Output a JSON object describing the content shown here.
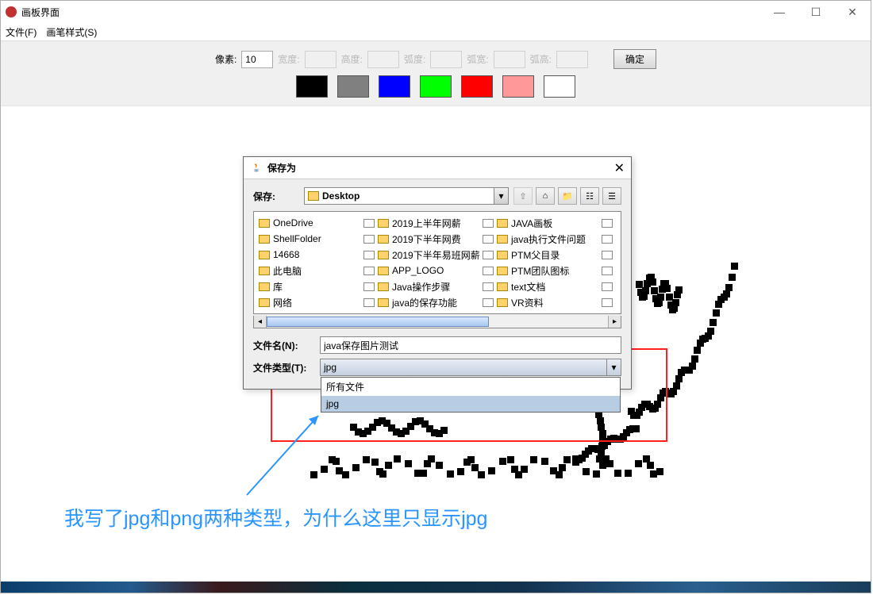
{
  "window": {
    "title": "画板界面",
    "minimize": "—",
    "maximize": "☐",
    "close": "✕"
  },
  "menubar": {
    "file": "文件(F)",
    "brush": "画笔样式(S)"
  },
  "toolbar": {
    "labels": {
      "pixel": "像素:",
      "width": "宽度:",
      "height": "高度:",
      "arc": "弧度:",
      "arcw": "弧宽:",
      "arch": "弧高:"
    },
    "pixel_value": "10",
    "ok": "确定",
    "colors": [
      "#000000",
      "#808080",
      "#0000ff",
      "#00ff00",
      "#ff0000",
      "#ff9999",
      "#ffffff"
    ]
  },
  "dialog": {
    "title": "保存为",
    "save_in_label": "保存:",
    "save_in_value": "Desktop",
    "files_col1": [
      "OneDrive",
      "ShellFolder",
      "14668",
      "此电脑",
      "库",
      "网络"
    ],
    "files_col2": [
      "2019上半年网薪",
      "2019下半年网费",
      "2019下半年易班网薪",
      "APP_LOGO",
      "Java操作步骤",
      "java的保存功能"
    ],
    "files_col3": [
      "JAVA画板",
      "java执行文件问题",
      "PTM父目录",
      "PTM团队图标",
      "text文档",
      "VR资料"
    ],
    "filename_label": "文件名(N):",
    "filename_value": "java保存图片测试",
    "filetype_label": "文件类型(T):",
    "filetype_value": "jpg",
    "filetype_options": [
      "所有文件",
      "jpg"
    ]
  },
  "annotation": {
    "text": "我写了jpg和png两种类型，为什么这里只显示jpg"
  }
}
